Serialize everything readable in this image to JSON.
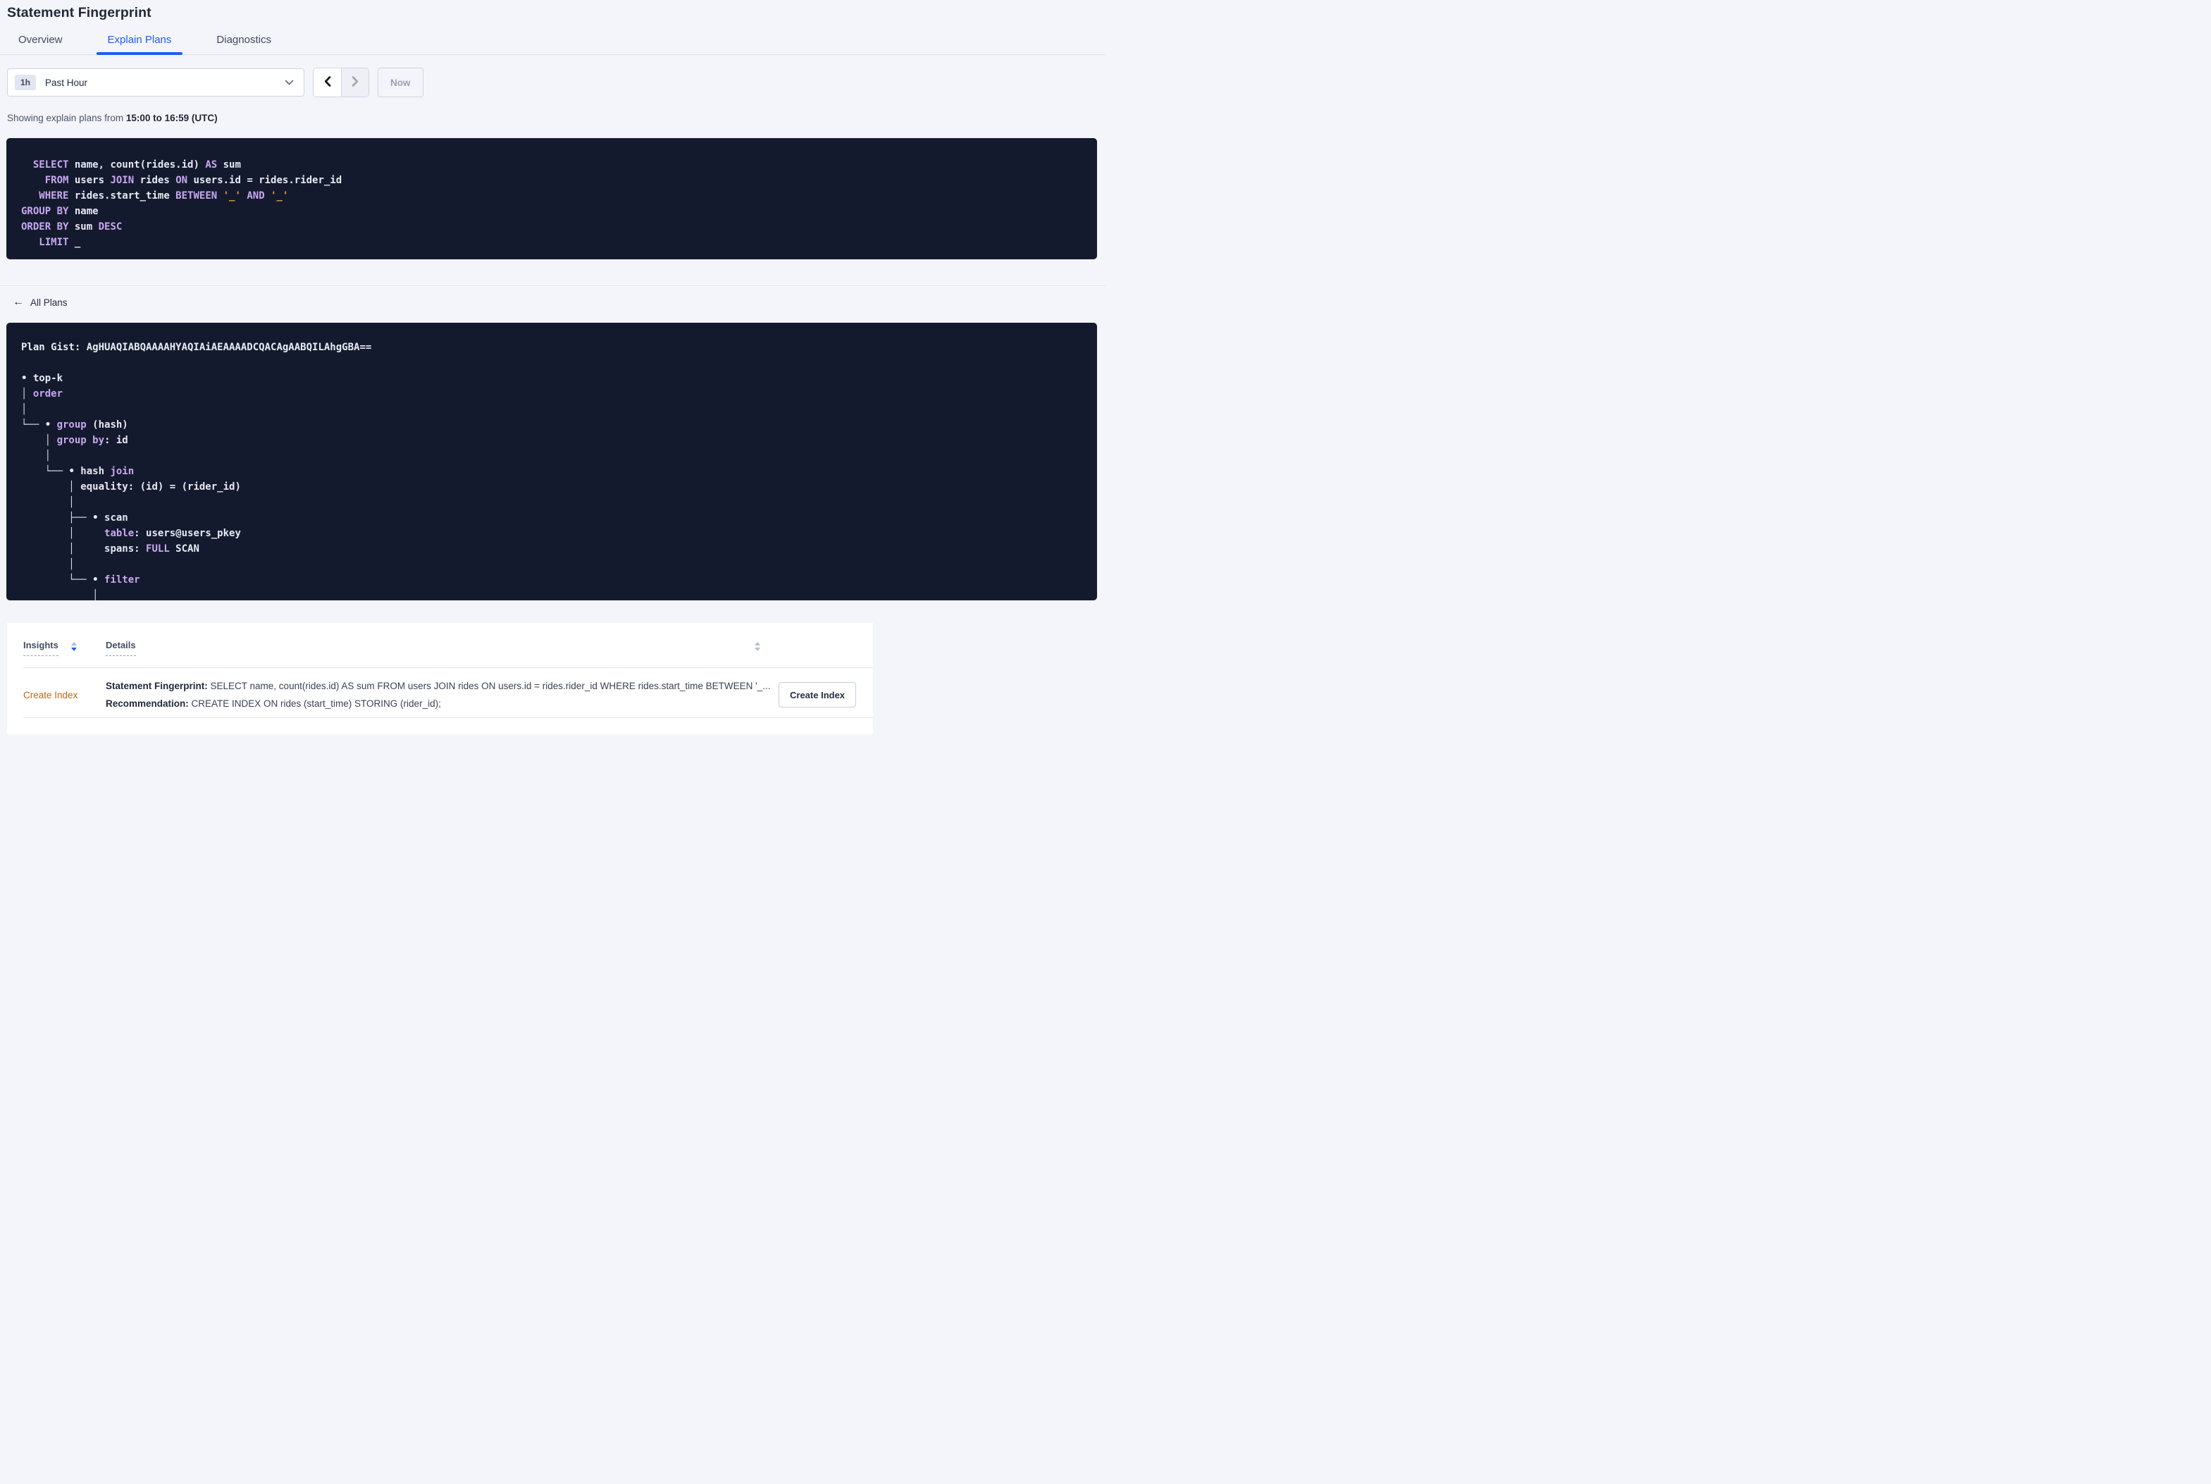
{
  "page_title": "Statement Fingerprint",
  "tabs": [
    {
      "label": "Overview",
      "active": false
    },
    {
      "label": "Explain Plans",
      "active": true
    },
    {
      "label": "Diagnostics",
      "active": false
    }
  ],
  "time_controls": {
    "range_badge": "1h",
    "range_label": "Past Hour",
    "now_label": "Now"
  },
  "showing_line": {
    "prefix": "Showing explain plans from ",
    "bold_range": "15:00 to 16:59 (UTC)"
  },
  "sql": {
    "lines": [
      [
        [
          "k",
          "  SELECT"
        ],
        [
          "t",
          " name, count(rides.id) "
        ],
        [
          "k",
          "AS"
        ],
        [
          "t",
          " sum"
        ]
      ],
      [
        [
          "t",
          "    "
        ],
        [
          "k",
          "FROM"
        ],
        [
          "t",
          " users "
        ],
        [
          "k",
          "JOIN"
        ],
        [
          "t",
          " rides "
        ],
        [
          "k",
          "ON"
        ],
        [
          "t",
          " users.id = rides.rider_id"
        ]
      ],
      [
        [
          "t",
          "   "
        ],
        [
          "k",
          "WHERE"
        ],
        [
          "t",
          " rides.start_time "
        ],
        [
          "k",
          "BETWEEN"
        ],
        [
          "t",
          " "
        ],
        [
          "s",
          "'_'"
        ],
        [
          "t",
          " "
        ],
        [
          "k",
          "AND"
        ],
        [
          "t",
          " "
        ],
        [
          "s",
          "'_'"
        ]
      ],
      [
        [
          "k",
          "GROUP BY"
        ],
        [
          "t",
          " name"
        ]
      ],
      [
        [
          "k",
          "ORDER BY"
        ],
        [
          "t",
          " sum "
        ],
        [
          "k",
          "DESC"
        ]
      ],
      [
        [
          "t",
          "   "
        ],
        [
          "k",
          "LIMIT"
        ],
        [
          "t",
          " _"
        ]
      ]
    ]
  },
  "back_link": {
    "arrow": "←",
    "label": "All Plans"
  },
  "plan": {
    "gist_label": "Plan Gist: ",
    "gist": "AgHUAQIABQAAAAHYAQIAiAEAAAADCQACAgAABQILAhgGBA==",
    "tree": [
      [
        [
          "t",
          "• top-k"
        ]
      ],
      [
        [
          "l",
          "│ "
        ],
        [
          "k",
          "order"
        ]
      ],
      [
        [
          "l",
          "│"
        ]
      ],
      [
        [
          "l",
          "└── "
        ],
        [
          "t",
          "• "
        ],
        [
          "k",
          "group"
        ],
        [
          "t",
          " (hash)"
        ]
      ],
      [
        [
          "l",
          "    │ "
        ],
        [
          "k",
          "group by"
        ],
        [
          "t",
          ": id"
        ]
      ],
      [
        [
          "l",
          "    │"
        ]
      ],
      [
        [
          "l",
          "    └── "
        ],
        [
          "t",
          "• hash "
        ],
        [
          "k",
          "join"
        ]
      ],
      [
        [
          "l",
          "        │ "
        ],
        [
          "t",
          "equality: (id) = (rider_id)"
        ]
      ],
      [
        [
          "l",
          "        │"
        ]
      ],
      [
        [
          "l",
          "        ├── "
        ],
        [
          "t",
          "• scan"
        ]
      ],
      [
        [
          "l",
          "        │     "
        ],
        [
          "k",
          "table"
        ],
        [
          "t",
          ": users@users_pkey"
        ]
      ],
      [
        [
          "l",
          "        │     "
        ],
        [
          "t",
          "spans: "
        ],
        [
          "k",
          "FULL"
        ],
        [
          "t",
          " SCAN"
        ]
      ],
      [
        [
          "l",
          "        │"
        ]
      ],
      [
        [
          "l",
          "        └── "
        ],
        [
          "t",
          "• "
        ],
        [
          "k",
          "filter"
        ]
      ],
      [
        [
          "l",
          "            │"
        ]
      ]
    ]
  },
  "insights_table": {
    "columns": [
      {
        "label": "Insights",
        "sorted": "desc"
      },
      {
        "label": "Details",
        "sorted": null
      }
    ],
    "rows": [
      {
        "insight": "Create Index",
        "fingerprint_label": "Statement Fingerprint:",
        "fingerprint_text": " SELECT name, count(rides.id) AS sum FROM users JOIN rides ON users.id = rides.rider_id WHERE rides.start_time BETWEEN '_...",
        "recommendation_label": "Recommendation:",
        "recommendation_text": " CREATE INDEX ON rides (start_time) STORING (rider_id);",
        "action_label": "Create Index"
      }
    ]
  },
  "colors": {
    "accent_blue": "#1b5ef7",
    "code_background": "#141a2e",
    "code_keyword": "#c9a8ef",
    "code_text": "#e7eaf3",
    "code_literal": "#e8a33d",
    "insight_orange": "#bb6a0e"
  }
}
